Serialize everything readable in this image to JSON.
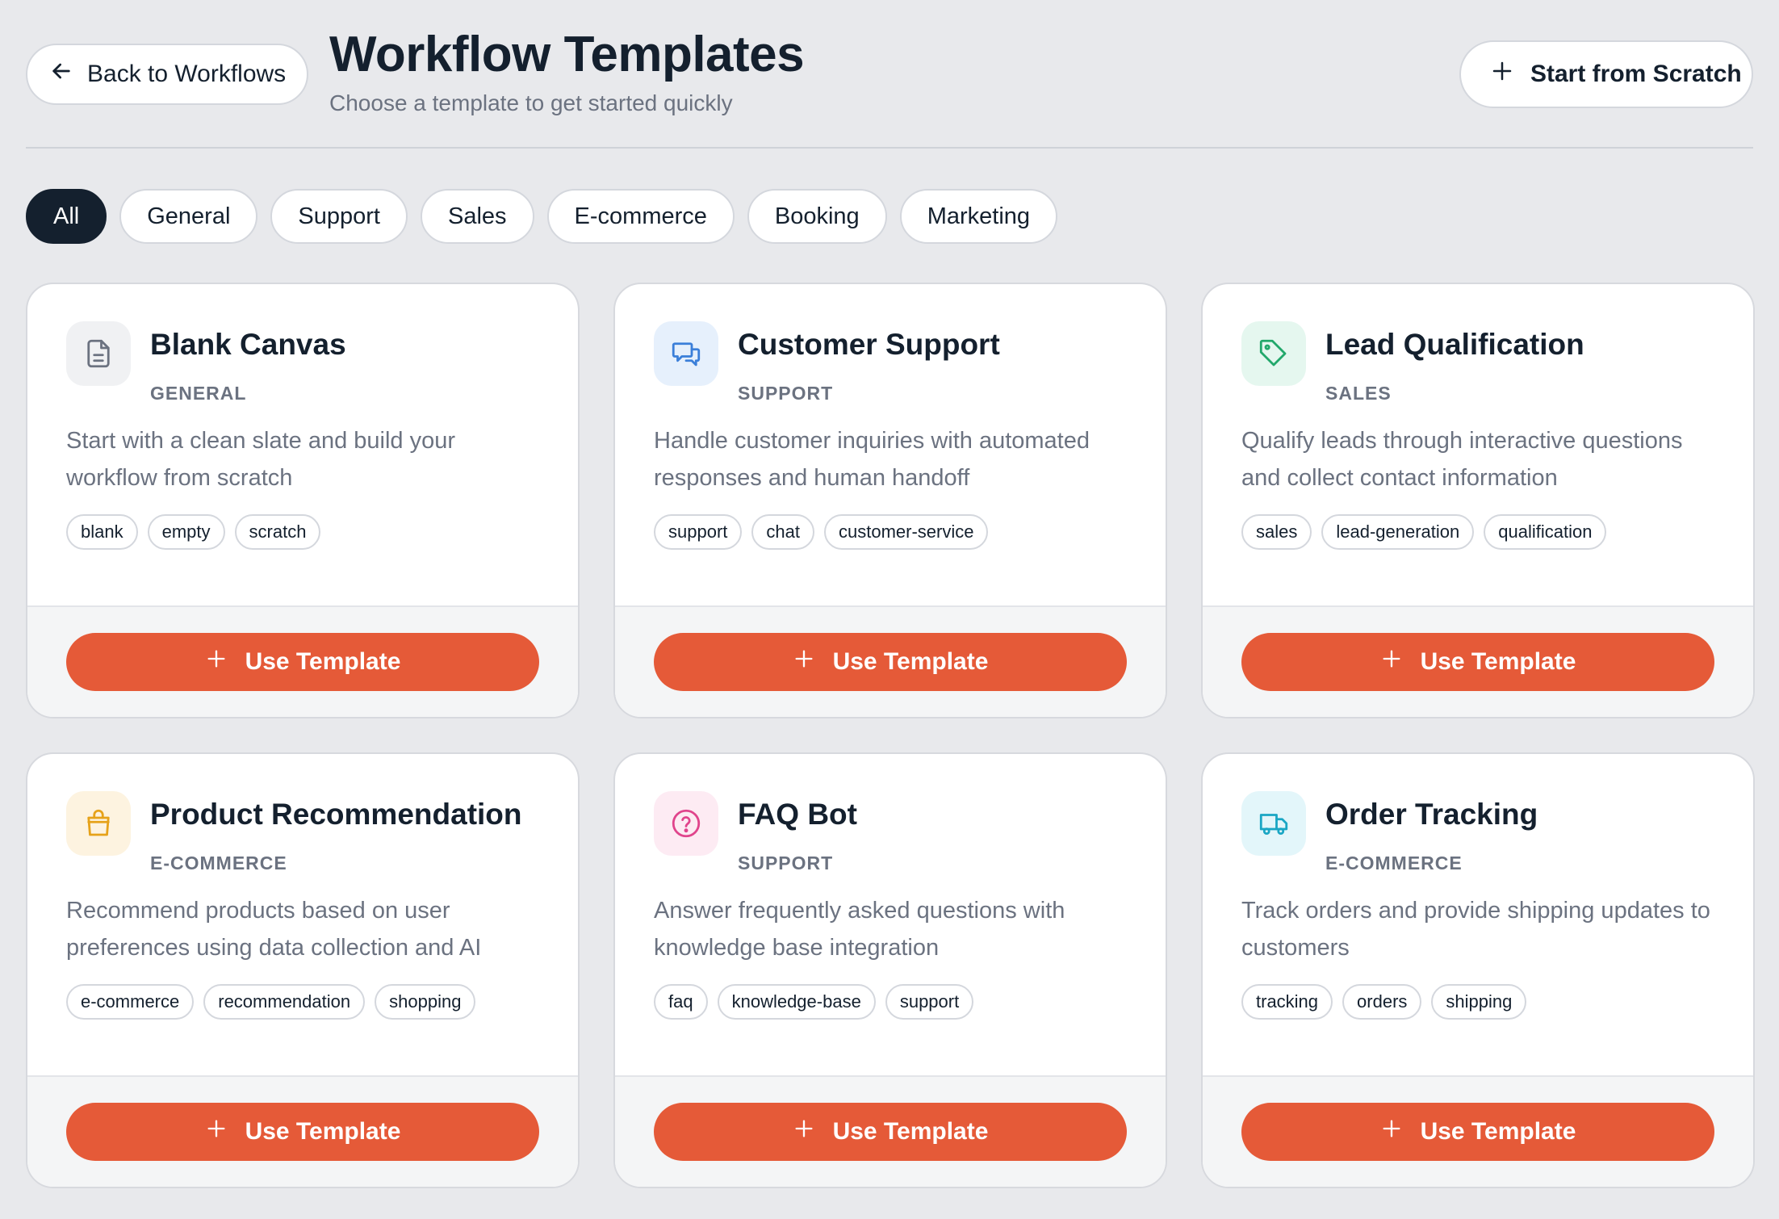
{
  "header": {
    "back_label": "Back to Workflows",
    "title": "Workflow Templates",
    "subtitle": "Choose a template to get started quickly",
    "scratch_label": "Start from Scratch"
  },
  "filters": [
    "All",
    "General",
    "Support",
    "Sales",
    "E-commerce",
    "Booking",
    "Marketing"
  ],
  "active_filter": "All",
  "use_label": "Use Template",
  "templates": [
    {
      "title": "Blank Canvas",
      "category": "GENERAL",
      "description": "Start with a clean slate and build your workflow from scratch",
      "tags": [
        "blank",
        "empty",
        "scratch"
      ],
      "icon": "document-icon"
    },
    {
      "title": "Customer Support",
      "category": "SUPPORT",
      "description": "Handle customer inquiries with automated responses and human handoff",
      "tags": [
        "support",
        "chat",
        "customer-service"
      ],
      "icon": "chat-icon"
    },
    {
      "title": "Lead Qualification",
      "category": "SALES",
      "description": "Qualify leads through interactive questions and collect contact information",
      "tags": [
        "sales",
        "lead-generation",
        "qualification"
      ],
      "icon": "tag-icon"
    },
    {
      "title": "Product Recommendation",
      "category": "E-COMMERCE",
      "description": "Recommend products based on user preferences using data collection and AI",
      "tags": [
        "e-commerce",
        "recommendation",
        "shopping"
      ],
      "icon": "shopping-bag-icon"
    },
    {
      "title": "FAQ Bot",
      "category": "SUPPORT",
      "description": "Answer frequently asked questions with knowledge base integration",
      "tags": [
        "faq",
        "knowledge-base",
        "support"
      ],
      "icon": "help-circle-icon"
    },
    {
      "title": "Order Tracking",
      "category": "E-COMMERCE",
      "description": "Track orders and provide shipping updates to customers",
      "tags": [
        "tracking",
        "orders",
        "shipping"
      ],
      "icon": "truck-icon"
    }
  ],
  "colors": {
    "accent": "#e55a38",
    "dark": "#14202e",
    "muted": "#6b7280",
    "icon_gray": "#f0f1f3",
    "icon_blue": "#e6f0fc",
    "icon_green": "#e5f7ef",
    "icon_amber": "#fdf3e0",
    "icon_pink": "#fdebf3",
    "icon_cyan": "#e3f6fa"
  }
}
